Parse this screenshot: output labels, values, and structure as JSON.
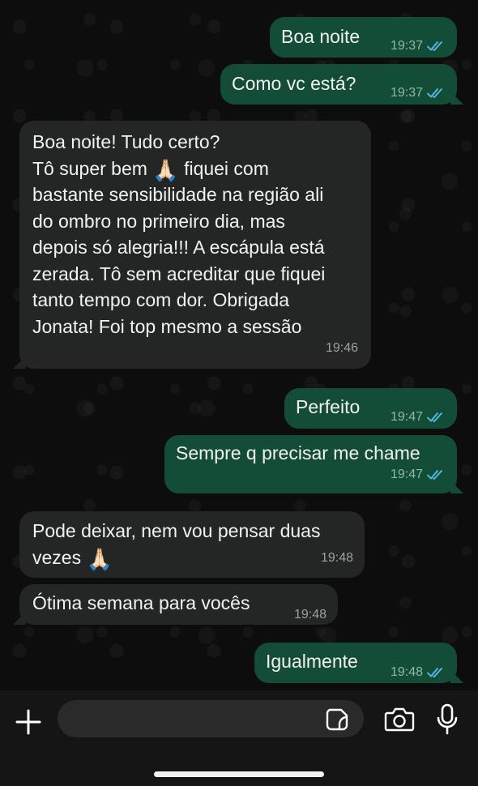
{
  "messages": [
    {
      "direction": "outgoing",
      "text": "Boa noite",
      "time": "19:37",
      "read": true
    },
    {
      "direction": "outgoing",
      "text": "Como vc está?",
      "time": "19:37",
      "read": true
    },
    {
      "direction": "incoming",
      "lines": [
        "Boa noite! Tudo certo?",
        "Tô super bem",
        "fiquei com",
        "bastante sensibilidade na região ali",
        "do ombro no primeiro dia, mas",
        "depois só alegria!!! A escápula está",
        "zerada. Tô sem acreditar que fiquei",
        "tanto tempo com dor. Obrigada",
        "Jonata! Foi top mesmo a sessão"
      ],
      "emoji": "🙏🏻",
      "time": "19:46"
    },
    {
      "direction": "outgoing",
      "text": "Perfeito",
      "time": "19:47",
      "read": true
    },
    {
      "direction": "outgoing",
      "text": "Sempre q precisar me chame",
      "time": "19:47",
      "read": true
    },
    {
      "direction": "incoming",
      "lines": [
        "Pode deixar, nem vou pensar duas",
        "vezes"
      ],
      "emoji": "🙏🏻",
      "time": "19:48"
    },
    {
      "direction": "incoming",
      "text": "Ótima semana para vocês",
      "time": "19:48"
    },
    {
      "direction": "outgoing",
      "text": "Igualmente",
      "time": "19:48",
      "read": true
    }
  ],
  "composer": {
    "placeholder": "",
    "icons": [
      "plus-icon",
      "sticker-icon",
      "camera-icon",
      "microphone-icon"
    ]
  },
  "colors": {
    "outgoing_bubble": "#144d37",
    "incoming_bubble": "#242626",
    "read_ticks": "#53bdeb",
    "background": "#0d0d0d"
  }
}
